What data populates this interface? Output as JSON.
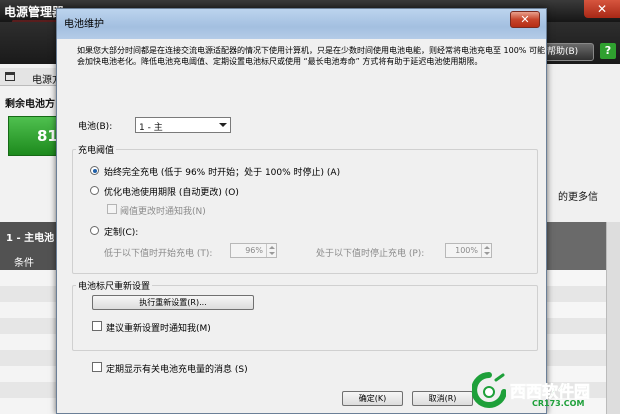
{
  "background_app": {
    "title": "电源管理器",
    "close_glyph": "✕",
    "help_glyph": "?",
    "right_button": "帮助(B)",
    "tab_label": "电源方",
    "remaining_label": "剩余电池方",
    "battery_percent": "81",
    "list_item": "1 - 主电池",
    "list_item_sub": "条件",
    "right_text": "的更多信"
  },
  "dialog": {
    "title": "电池维护",
    "close_glyph": "✕",
    "description": "如果您大部分时间都是在连接交流电源适配器的情况下使用计算机，只是在少数时间使用电池电能，则经常将电池充电至 100% 可能会加快电池老化。降低电池充电阈值、定期设置电池标尺或使用 “最长电池寿命” 方式将有助于延迟电池使用期限。",
    "battery_label": "电池(B):",
    "battery_value": "1 - 主",
    "threshold_group": "充电阈值",
    "option_full": "始终完全充电 (低于 96% 时开始；处于 100% 时停止) (A)",
    "option_optimize": "优化电池使用期限 (自动更改) (O)",
    "notify_threshold": "阈值更改时通知我(N)",
    "option_custom": "定制(C):",
    "start_label": "低于以下值时开始充电 (T):",
    "start_value": "96%",
    "stop_label": "处于以下值时停止充电 (P):",
    "stop_value": "100%",
    "gauge_group": "电池标尺重新设置",
    "reset_button": "执行重新设置(R)...",
    "recommend_reset": "建议重新设置时通知我(M)",
    "periodic_message": "定期显示有关电池充电量的消息 (S)",
    "ok_button": "确定(K)",
    "cancel_button": "取消(R)",
    "selected_option": "full"
  },
  "watermark": {
    "text": "西西软件园",
    "url": "CR173.COM"
  },
  "colors": {
    "accent": "#1f5fa8",
    "titlebar": "#a3bfe0",
    "battery_green": "#2f9f2f",
    "watermark_green": "#1ea03a"
  }
}
